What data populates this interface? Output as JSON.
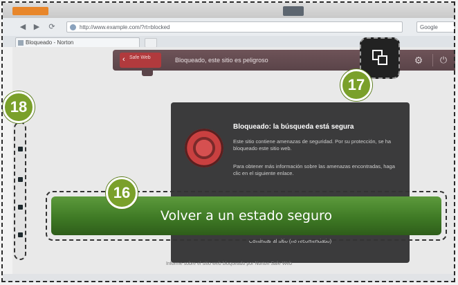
{
  "browser": {
    "url": "http://www.example.com/?rt=blocked",
    "search_placeholder": "Google",
    "tab_title": "Bloqueado - Norton",
    "nav": {
      "back": "◀",
      "forward": "▶",
      "refresh": "⟳"
    }
  },
  "extension_bar": {
    "badge_text": "Safe Web",
    "status_text": "Bloqueado, este sitio es peligroso"
  },
  "panel": {
    "title": "Bloqueado: la búsqueda está segura",
    "para1": "Este sitio contiene amenazas de seguridad. Por su protección, se ha bloqueado este sitio web.",
    "para2": "Para obtener más información sobre las amenazas encontradas, haga clic en el siguiente enlace.",
    "footer_link": "Continuar al sitio (no recomendado)",
    "footnote": "Informe sobre el sitio web bloqueado por Norton Safe Web"
  },
  "cta": {
    "label": "Volver a un estado seguro"
  },
  "callouts": {
    "c16": "16",
    "c17": "17",
    "c18": "18"
  },
  "icons": {
    "gear": "⚙",
    "power": "⏻"
  },
  "colors": {
    "accent_green": "#4a8a2d",
    "callout_green": "#7aa02a",
    "ext_bar": "#5f484d",
    "badge_red": "#b13a3d"
  }
}
